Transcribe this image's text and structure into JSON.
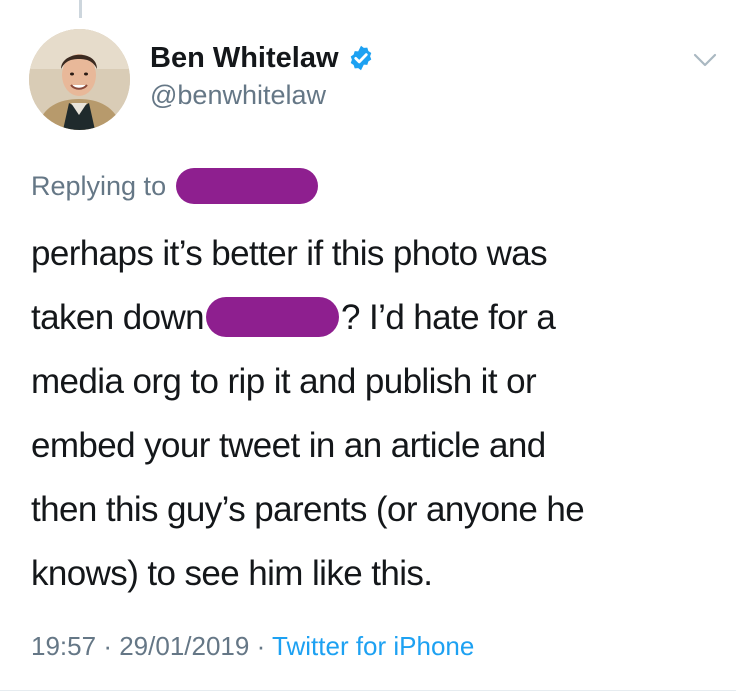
{
  "tweet": {
    "author": {
      "display_name": "Ben Whitelaw",
      "handle": "@benwhitelaw",
      "verified": true
    },
    "reply_prefix": "Replying to",
    "text_lines": [
      {
        "before": "perhaps it’s better if this photo was",
        "after": ""
      },
      {
        "before": "taken down",
        "after": "? I’d hate for a"
      },
      {
        "before": "media org to rip it and publish it or",
        "after": ""
      },
      {
        "before": "embed your tweet in an article and",
        "after": ""
      },
      {
        "before": "then this guy’s parents (or anyone he",
        "after": ""
      },
      {
        "before": "knows) to see him like this.",
        "after": ""
      }
    ],
    "time": "19:57",
    "date": "29/01/2019",
    "separator": "·",
    "source": "Twitter for iPhone"
  },
  "icons": {
    "verified": "verified-badge-icon",
    "menu": "chevron-down-icon"
  },
  "colors": {
    "text": "#14171a",
    "secondary": "#657786",
    "link": "#1da1f2",
    "verified": "#1da1f2",
    "redaction": "#8e1f8f"
  }
}
